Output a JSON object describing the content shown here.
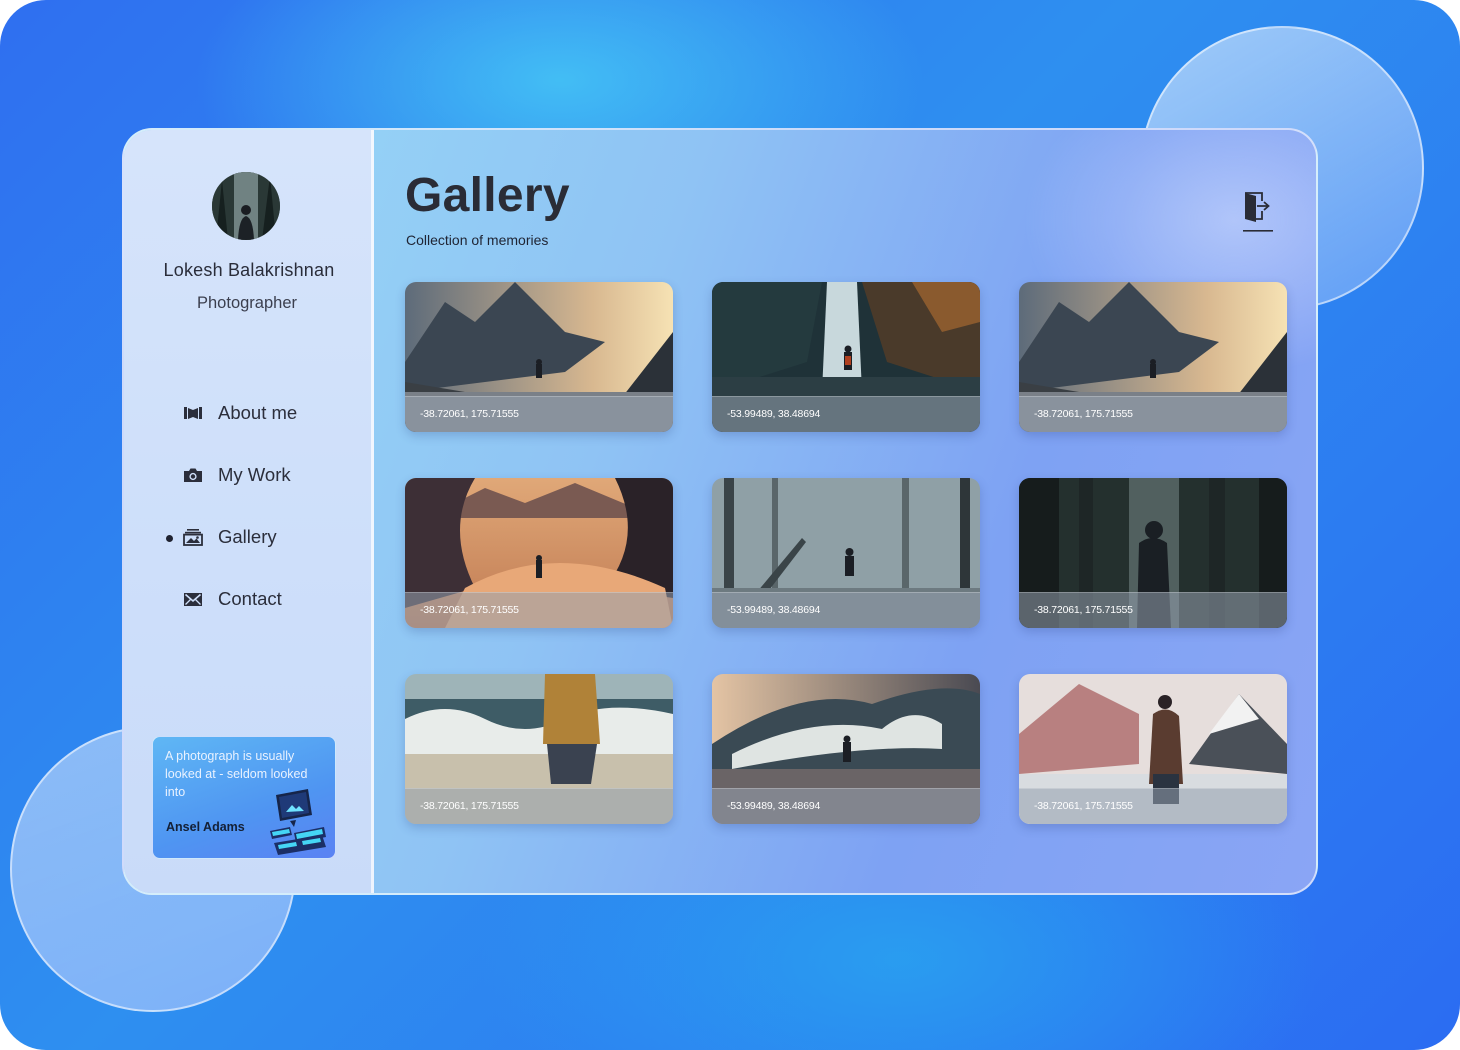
{
  "profile": {
    "name": "Lokesh Balakrishnan",
    "role": "Photographer"
  },
  "nav": {
    "items": [
      {
        "label": "About me",
        "icon": "book-icon",
        "active": false
      },
      {
        "label": "My Work",
        "icon": "camera-icon",
        "active": false
      },
      {
        "label": "Gallery",
        "icon": "gallery-icon",
        "active": true
      },
      {
        "label": "Contact",
        "icon": "envelope-icon",
        "active": false
      }
    ]
  },
  "quote": {
    "text": "A photograph is usually looked at - seldom looked into",
    "author": "Ansel Adams"
  },
  "header": {
    "title": "Gallery",
    "subtitle": "Collection of memories",
    "logout_icon": "logout-icon"
  },
  "gallery": {
    "photos": [
      {
        "caption": "-38.72061, 175.71555",
        "scene": "mountain-valley"
      },
      {
        "caption": "-53.99489, 38.48694",
        "scene": "waterfall"
      },
      {
        "caption": "-38.72061, 175.71555",
        "scene": "mountain-valley"
      },
      {
        "caption": "-38.72061, 175.71555",
        "scene": "desert-dunes"
      },
      {
        "caption": "-53.99489, 38.48694",
        "scene": "misty-forest"
      },
      {
        "caption": "-38.72061, 175.71555",
        "scene": "dark-forest"
      },
      {
        "caption": "-38.72061, 175.71555",
        "scene": "beach-waves"
      },
      {
        "caption": "-53.99489, 38.48694",
        "scene": "giant-wave"
      },
      {
        "caption": "-38.72061, 175.71555",
        "scene": "snowy-peak"
      }
    ]
  },
  "colors": {
    "background": "#2f6ff0",
    "accent_text": "#2a2c36",
    "sidebar": "#d6e4fb"
  }
}
